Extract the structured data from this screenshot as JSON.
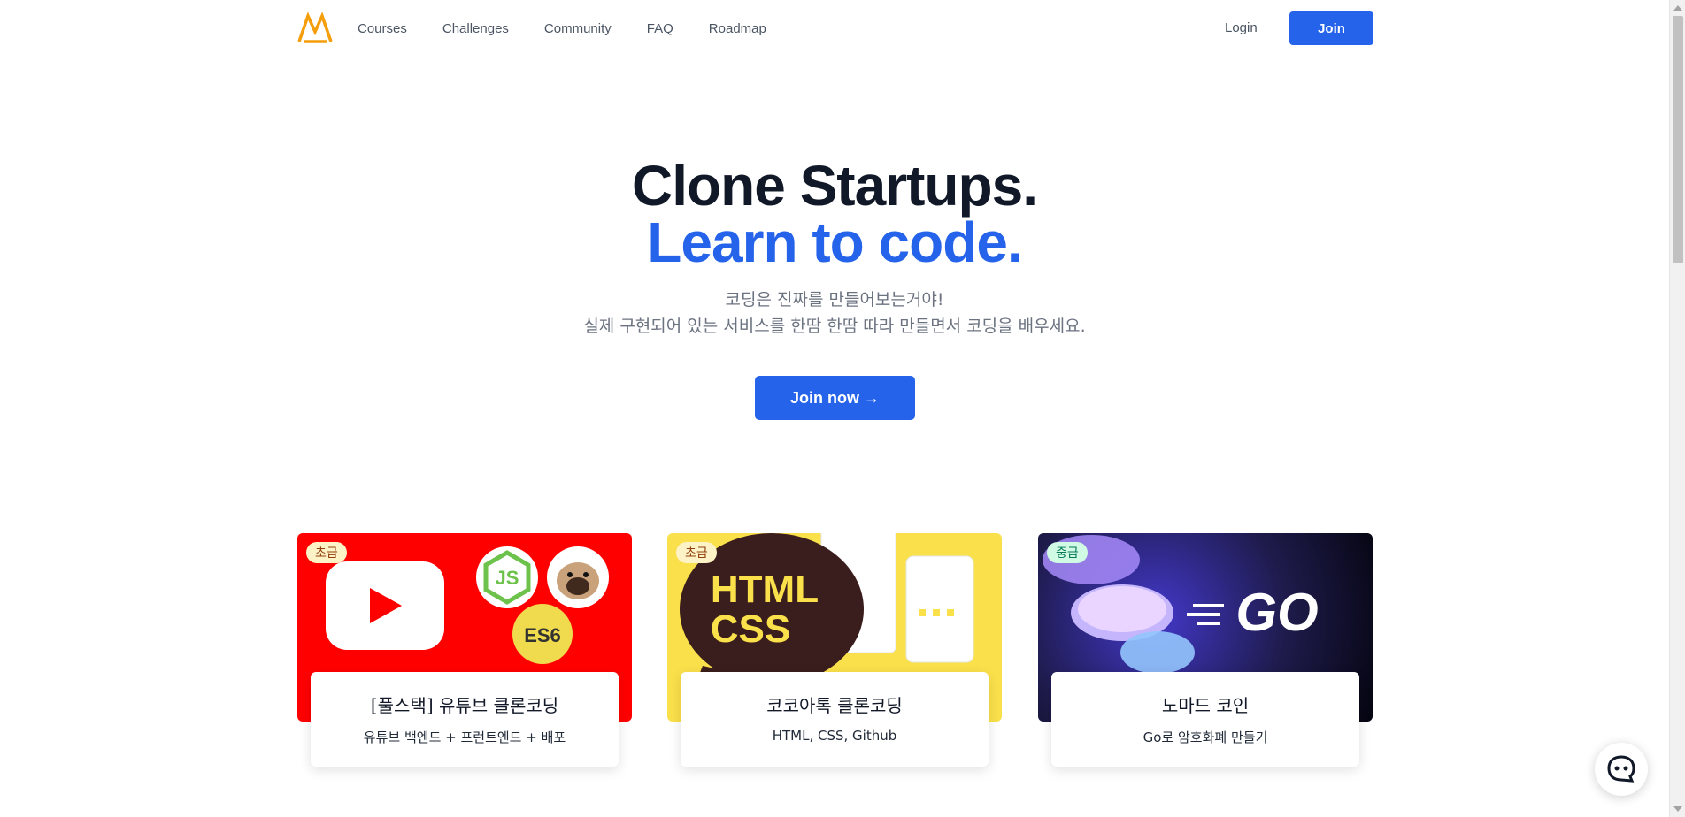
{
  "header": {
    "nav": [
      "Courses",
      "Challenges",
      "Community",
      "FAQ",
      "Roadmap"
    ],
    "login_label": "Login",
    "join_label": "Join"
  },
  "hero": {
    "line1": "Clone Startups.",
    "line2": "Learn to code.",
    "sub1": "코딩은 진짜를 만들어보는거야!",
    "sub2": "실제 구현되어 있는 서비스를 한땀 한땀 따라 만들면서 코딩을 배우세요.",
    "cta_label": "Join now →"
  },
  "courses": [
    {
      "badge": "초급",
      "title": "[풀스택] 유튜브 클론코딩",
      "desc": "유튜브 백엔드 + 프런트엔드 + 배포",
      "image_text": "ES6"
    },
    {
      "badge": "초급",
      "title": "코코아톡 클론코딩",
      "desc": "HTML, CSS, Github",
      "image_text": "HTML CSS"
    },
    {
      "badge": "중급",
      "title": "노마드 코인",
      "desc": "Go로 암호화폐 만들기",
      "image_text": "GO"
    }
  ],
  "colors": {
    "accent": "#2563eb",
    "logo": "#f59e0b",
    "youtube_red": "#ff0000",
    "kakao_yellow": "#fae04a",
    "go_dark": "#1e1b4b"
  },
  "icons": {
    "logo": "nomad-logo",
    "chat": "chat-icon"
  }
}
